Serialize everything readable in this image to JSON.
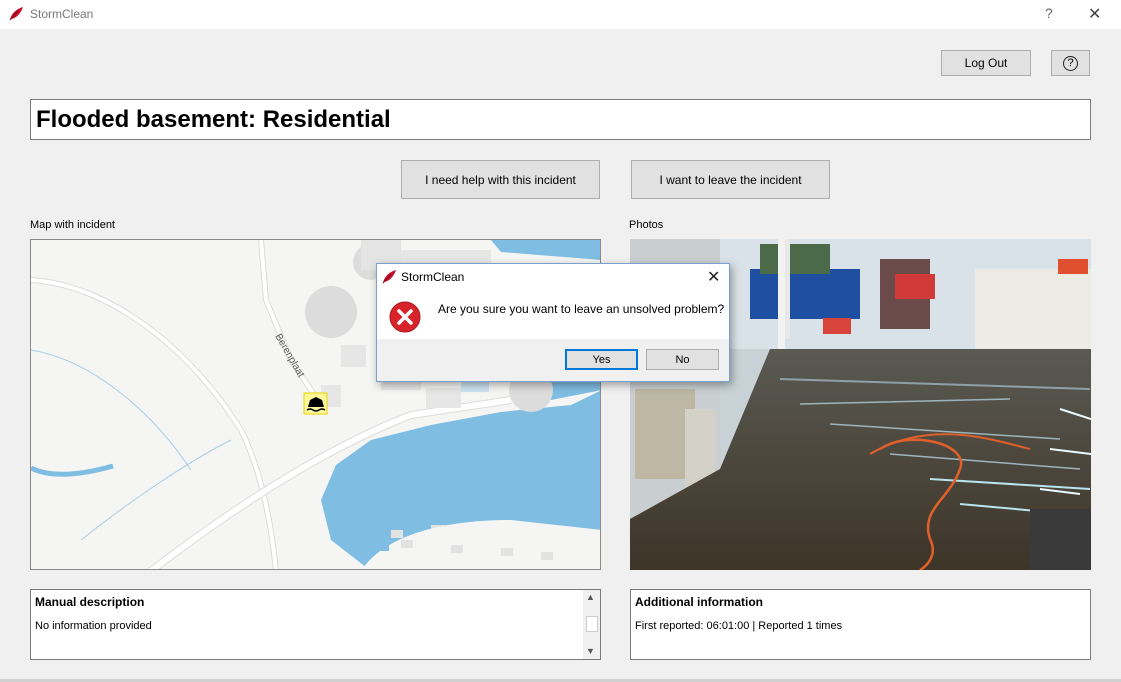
{
  "app": {
    "title": "StormClean"
  },
  "titlebar": {
    "help": "?",
    "close": "✕"
  },
  "header": {
    "logout_label": "Log Out",
    "help_label": "?"
  },
  "incident": {
    "title": "Flooded basement: Residential"
  },
  "actions": {
    "help_label": "I need help with this incident",
    "leave_label": "I want to leave the incident"
  },
  "map": {
    "label": "Map with incident",
    "street": "Berenplaat"
  },
  "photos": {
    "label": "Photos"
  },
  "description": {
    "header": "Manual description",
    "text": "No information provided"
  },
  "additional": {
    "header": "Additional information",
    "text": "First reported: 06:01:00 | Reported 1 times"
  },
  "dialog": {
    "title": "StormClean",
    "message": "Are you sure you want to leave an unsolved problem?",
    "yes_label": "Yes",
    "no_label": "No",
    "close": "✕"
  },
  "colors": {
    "accent": "#0078d7",
    "error_red": "#d8232a",
    "water": "#7fbde2",
    "logo_red": "#c8102e"
  }
}
